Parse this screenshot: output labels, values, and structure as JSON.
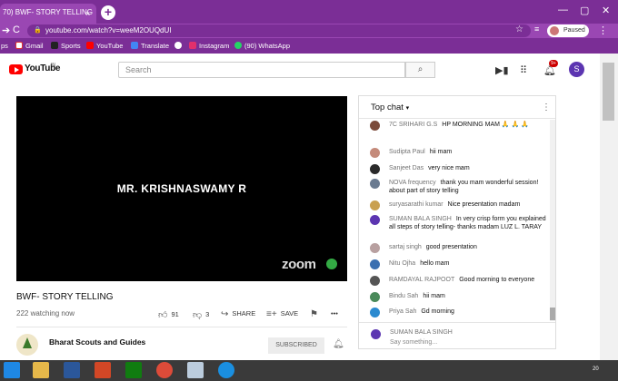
{
  "browser": {
    "tab_title": "70) BWF- STORY TELLING",
    "tab_close": "×",
    "new_tab": "+",
    "url": "youtube.com/watch?v=weeM2OUQdUI",
    "profile_status": "Paused",
    "bookmarks": [
      {
        "label": "ps",
        "color": "#4285f4"
      },
      {
        "label": "Gmail",
        "color": "#ffffff"
      },
      {
        "label": "Sports",
        "color": "#222222"
      },
      {
        "label": "YouTube",
        "color": "#ff0000"
      },
      {
        "label": "Translate",
        "color": "#4285f4"
      },
      {
        "label": "",
        "color": "#ffffff"
      },
      {
        "label": "Instagram",
        "color": "#e1306c"
      },
      {
        "label": "(90) WhatsApp",
        "color": "#25d366"
      }
    ]
  },
  "youtube": {
    "logo_text": "YouTube",
    "logo_region": "IN",
    "search_placeholder": "Search",
    "notification_count": "9+",
    "user_initial": "S"
  },
  "video": {
    "overlay_name": "MR. KRISHNASWAMY R",
    "watermark": "zoom",
    "title": "BWF- STORY TELLING",
    "watching": "222 watching now",
    "likes": "91",
    "dislikes": "3",
    "share_label": "SHARE",
    "save_label": "SAVE",
    "more_label": "•••"
  },
  "channel": {
    "name": "Bharat Scouts and Guides",
    "subscribed_label": "SUBSCRIBED"
  },
  "chat": {
    "header": "Top chat",
    "messages": [
      {
        "author": "7C SRIHARI G.S",
        "text": "HP MORNING MAM 🙏 🙏 🙏",
        "avatar_color": "#7b4a3a"
      },
      {
        "author": "Sudipta Paul",
        "text": "hii mam",
        "avatar_color": "#c48a7a"
      },
      {
        "author": "Sanjeet Das",
        "text": "very nice mam",
        "avatar_color": "#2a2a2a"
      },
      {
        "author": "NOVA frequency",
        "text": "thank you mam wonderful session! about part of story telling",
        "avatar_color": "#6a7a90"
      },
      {
        "author": "suryasarathi kumar",
        "text": "Nice presentation madam",
        "avatar_color": "#c9a050"
      },
      {
        "author": "SUMAN BALA SINGH",
        "text": "In very crisp form you explained all steps of story telling- thanks madam LUZ L. TARAY",
        "avatar_color": "#5c35b1"
      },
      {
        "author": "sartaj singh",
        "text": "good presentation",
        "avatar_color": "#b8a0a0"
      },
      {
        "author": "Nitu Ojha",
        "text": "hello mam",
        "avatar_color": "#3a6fb0"
      },
      {
        "author": "RAMDAYAL RAJPOOT",
        "text": "Good morning to everyone",
        "avatar_color": "#555555"
      },
      {
        "author": "Bindu Sah",
        "text": "hii mam",
        "avatar_color": "#4a8a5a"
      },
      {
        "author": "Priya Sah",
        "text": "Gd morning",
        "avatar_color": "#2a8ad0"
      }
    ],
    "input_name": "SUMAN BALA SINGH",
    "input_placeholder": "Say something..."
  },
  "taskbar": {
    "time": "20"
  }
}
